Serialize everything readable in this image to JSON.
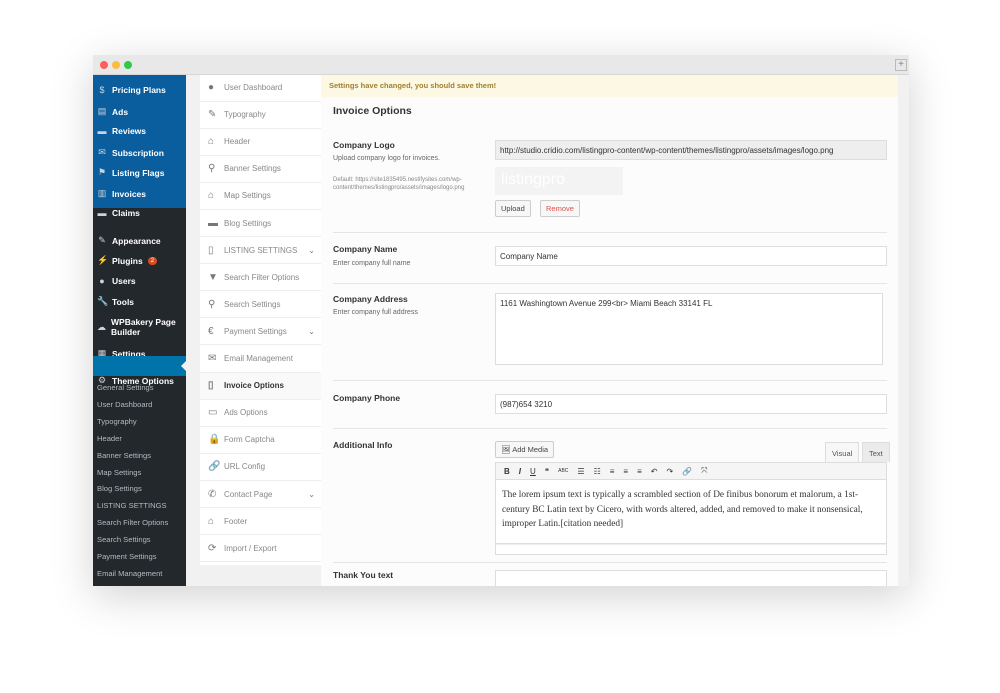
{
  "window": {
    "controls": {
      "close": "#fc605c",
      "minimize": "#fdbc40",
      "maximize": "#34c84a"
    },
    "plus_label": "+"
  },
  "admin_menu": {
    "items": [
      {
        "label": "Pricing Plans",
        "icon": "dollar-icon"
      },
      {
        "label": "Ads",
        "icon": "document-icon"
      },
      {
        "label": "Reviews",
        "icon": "comment-icon"
      },
      {
        "label": "Subscription",
        "icon": "envelope-icon"
      },
      {
        "label": "Listing Flags",
        "icon": "flag-icon"
      },
      {
        "label": "Invoices",
        "icon": "invoice-icon"
      },
      {
        "label": "Claims",
        "icon": "comment-icon"
      },
      {
        "label": "Appearance",
        "icon": "brush-icon"
      },
      {
        "label": "Plugins",
        "icon": "plugin-icon",
        "badge": "2"
      },
      {
        "label": "Users",
        "icon": "user-icon"
      },
      {
        "label": "Tools",
        "icon": "wrench-icon"
      },
      {
        "label": "WPBakery Page Builder",
        "icon": "cloud-icon"
      },
      {
        "label": "Settings",
        "icon": "settings-icon"
      },
      {
        "label": "Theme Options",
        "icon": "gear-icon"
      }
    ],
    "submenu": [
      "General Settings",
      "User Dashboard",
      "Typography",
      "Header",
      "Banner Settings",
      "Map Settings",
      "Blog Settings",
      "LISTING SETTINGS",
      "Search Filter Options",
      "Search Settings",
      "Payment Settings",
      "Email Management"
    ]
  },
  "theme_menu": [
    {
      "label": "User Dashboard",
      "icon": "user-icon"
    },
    {
      "label": "Typography",
      "icon": "edit-icon"
    },
    {
      "label": "Header",
      "icon": "home-icon"
    },
    {
      "label": "Banner Settings",
      "icon": "map-pin-icon"
    },
    {
      "label": "Map Settings",
      "icon": "home-icon"
    },
    {
      "label": "Blog Settings",
      "icon": "comment-icon"
    },
    {
      "label": "LISTING SETTINGS",
      "icon": "clipboard-icon",
      "expand": true
    },
    {
      "label": "Search Filter Options",
      "icon": "filter-icon"
    },
    {
      "label": "Search Settings",
      "icon": "search-icon"
    },
    {
      "label": "Payment Settings",
      "icon": "euro-icon",
      "expand": true
    },
    {
      "label": "Email Management",
      "icon": "envelope-icon"
    },
    {
      "label": "Invoice Options",
      "icon": "clipboard-icon",
      "active": true
    },
    {
      "label": "Ads Options",
      "icon": "monitor-icon"
    },
    {
      "label": "Form Captcha",
      "icon": "lock-icon"
    },
    {
      "label": "URL Config",
      "icon": "link-icon"
    },
    {
      "label": "Contact Page",
      "icon": "phone-icon",
      "expand": true
    },
    {
      "label": "Footer",
      "icon": "home-icon"
    },
    {
      "label": "Import / Export",
      "icon": "refresh-icon"
    }
  ],
  "main": {
    "notice": "Settings have changed, you should save them!",
    "title": "Invoice Options",
    "logo": {
      "label": "Company Logo",
      "desc": "Upload company logo for invoices.",
      "default": "Default: https://site1835495.nestifysites.com/wp-content/themes/listingpro/assets/images/logo.png",
      "value": "http://studio.cridio.com/listingpro-content/wp-content/themes/listingpro/assets/images/logo.png",
      "preview_text": "listingpro",
      "upload": "Upload",
      "remove": "Remove"
    },
    "name": {
      "label": "Company Name",
      "desc": "Enter company full name",
      "value": "Company Name"
    },
    "address": {
      "label": "Company Address",
      "desc": "Enter company full address",
      "value": "1161 Washingtown Avenue 299<br> Miami Beach 33141 FL"
    },
    "phone": {
      "label": "Company Phone",
      "value": "(987)654 3210"
    },
    "info": {
      "label": "Additional Info",
      "add_media": "Add Media",
      "tab_visual": "Visual",
      "tab_text": "Text",
      "toolbar": [
        "B",
        "I",
        "U",
        "❝",
        "ABC",
        "☰",
        "☷",
        "≡",
        "≡",
        "≡",
        "↶",
        "↷",
        "🔗",
        "⤧"
      ],
      "content": "The lorem ipsum text is typically a scrambled section of De finibus bonorum et malorum, a 1st-century BC Latin text by Cicero, with words altered, added, and removed to make it nonsensical, improper Latin.[citation needed]"
    },
    "thankyou": {
      "label": "Thank You text"
    }
  }
}
